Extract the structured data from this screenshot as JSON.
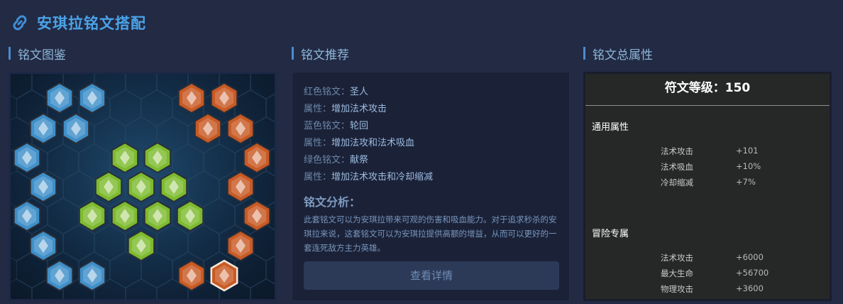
{
  "header": {
    "title": "安琪拉铭文搭配"
  },
  "sections": {
    "gallery": "铭文图鉴",
    "recommend": "铭文推荐",
    "totals": "铭文总属性"
  },
  "recommend": {
    "rows": [
      {
        "label": "红色铭文：",
        "value": "圣人"
      },
      {
        "label": "属性：",
        "value": "增加法术攻击"
      },
      {
        "label": "蓝色铭文：",
        "value": "轮回"
      },
      {
        "label": "属性：",
        "value": "增加法攻和法术吸血"
      },
      {
        "label": "绿色铭文：",
        "value": "献祭"
      },
      {
        "label": "属性：",
        "value": "增加法术攻击和冷却缩减"
      }
    ],
    "analysis_title": "铭文分析：",
    "analysis_text": "此套铭文可以为安琪拉带来可观的伤害和吸血能力。对于追求秒杀的安琪拉来说，这套铭文可以为安琪拉提供高额的增益，从而可以更好的一套连死敌方主力英雄。",
    "button": "查看详情"
  },
  "totals": {
    "level_label": "符文等级：150",
    "general_title": "通用属性",
    "general": [
      {
        "name": "法术攻击",
        "value": "+101"
      },
      {
        "name": "法术吸血",
        "value": "+10%"
      },
      {
        "name": "冷却缩减",
        "value": "+7%"
      }
    ],
    "adventure_title": "冒险专属",
    "adventure": [
      {
        "name": "法术攻击",
        "value": "+6000"
      },
      {
        "name": "最大生命",
        "value": "+56700"
      },
      {
        "name": "物理攻击",
        "value": "+3600"
      }
    ]
  },
  "board": {
    "blue": "#3f8fc8",
    "green": "#7dbb2e",
    "red": "#c85a24"
  }
}
